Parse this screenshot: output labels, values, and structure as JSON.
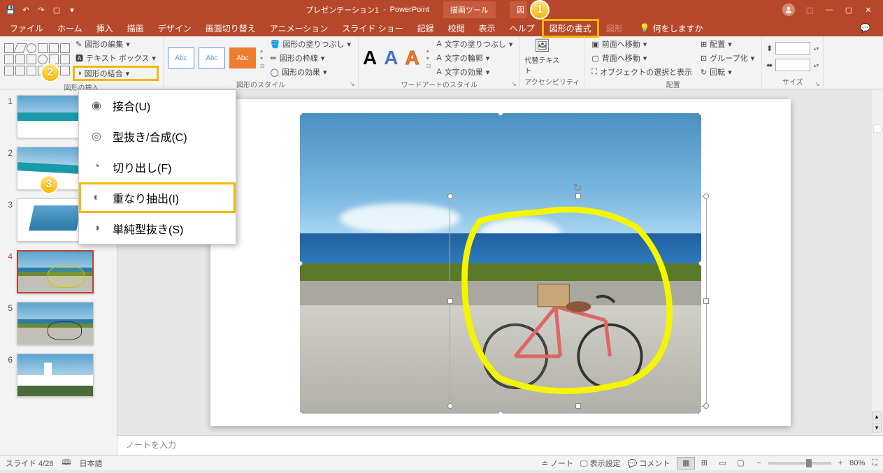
{
  "titlebar": {
    "doc_name": "プレゼンテーション1",
    "app_name": "PowerPoint",
    "drawing_tools": "描画ツール",
    "picture_tools": "図"
  },
  "tabs": {
    "file": "ファイル",
    "home": "ホーム",
    "insert": "挿入",
    "draw": "描画",
    "design": "デザイン",
    "transitions": "画面切り替え",
    "animations": "アニメーション",
    "slideshow": "スライド ショー",
    "record": "記録",
    "review": "校閲",
    "view": "表示",
    "help": "ヘルプ",
    "shape_format": "図形の書式",
    "picture_format": "図形",
    "tell_me": "何をしますか"
  },
  "ribbon": {
    "insert_shapes": {
      "edit_shape": "図形の編集",
      "text_box": "テキスト ボックス",
      "merge_shapes": "図形の結合",
      "label": "図形の挿入"
    },
    "shape_styles": {
      "sample": "Abc",
      "fill": "図形の塗りつぶし",
      "outline": "図形の枠線",
      "effects": "図形の効果",
      "label": "図形のスタイル"
    },
    "wordart": {
      "text_fill": "文字の塗りつぶし",
      "text_outline": "文字の輪郭",
      "text_effects": "文字の効果",
      "label": "ワードアートのスタイル"
    },
    "accessibility": {
      "alt_text": "代替テキスト",
      "label": "アクセシビリティ"
    },
    "arrange": {
      "bring_forward": "前面へ移動",
      "send_backward": "背面へ移動",
      "selection_pane": "オブジェクトの選択と表示",
      "align": "配置",
      "group": "グループ化",
      "rotate": "回転",
      "label": "配置"
    },
    "size": {
      "label": "サイズ"
    }
  },
  "dropdown": {
    "union": "接合(U)",
    "combine": "型抜き/合成(C)",
    "fragment": "切り出し(F)",
    "intersect": "重なり抽出(I)",
    "subtract": "単純型抜き(S)"
  },
  "slides": {
    "nums": [
      "1",
      "2",
      "3",
      "4",
      "5",
      "6"
    ]
  },
  "notes": {
    "placeholder": "ノートを入力"
  },
  "status": {
    "slide_info": "スライド 4/28",
    "language": "日本語",
    "notes_btn": "ノート",
    "display_settings": "表示設定",
    "comments": "コメント",
    "zoom": "80%"
  },
  "annotations": {
    "one": "1",
    "two": "2",
    "three": "3"
  }
}
